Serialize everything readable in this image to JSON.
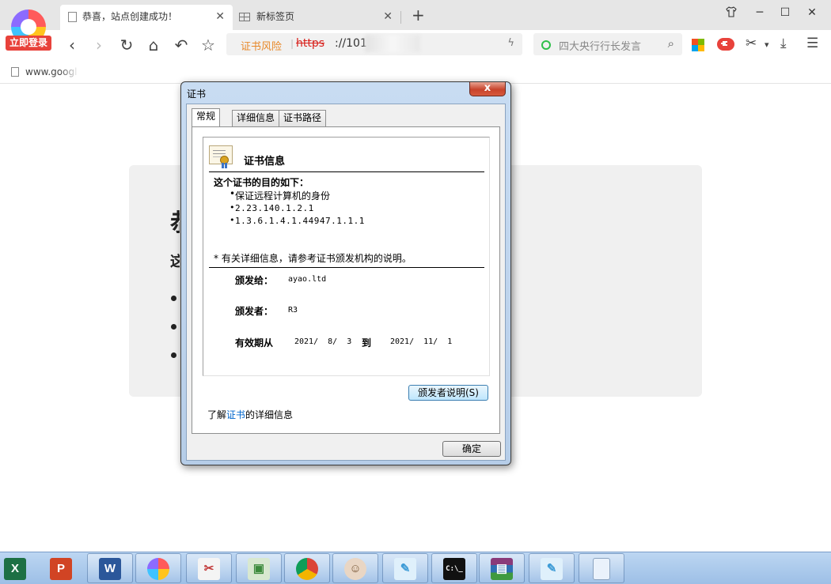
{
  "browser": {
    "login_label": "立即登录",
    "tabs": [
      {
        "title": "恭喜，站点创建成功！",
        "active": true
      },
      {
        "title": "新标签页",
        "active": false
      }
    ],
    "new_tab": "+",
    "window_controls": {
      "skin": "shirt-icon",
      "minimize": "─",
      "maximize": "☐",
      "close": "✕"
    },
    "nav": {
      "back": "‹",
      "forward": "›",
      "reload": "↻",
      "home": "⌂",
      "undo": "↶",
      "star": "☆"
    },
    "address": {
      "risk_label": "证书风险",
      "scheme": "https",
      "host": "://101.32"
    },
    "search": {
      "placeholder": "四大央行行长发言"
    },
    "toolbar_glyphs": {
      "scissors": "✂",
      "dropdown": "▾",
      "download": "⤓",
      "menu": "☰"
    },
    "bookmark": {
      "label": "www.googl"
    }
  },
  "page": {
    "heading": "恭喜",
    "subheading": "这"
  },
  "dialog": {
    "title": "证书",
    "close": "x",
    "tabs": [
      "常规",
      "详细信息",
      "证书路径"
    ],
    "info_title": "证书信息",
    "purpose_title": "这个证书的目的如下：",
    "purposes": [
      "保证远程计算机的身份",
      "2.23.140.1.2.1",
      "1.3.6.1.4.1.44947.1.1.1"
    ],
    "note": "* 有关详细信息，请参考证书颁发机构的说明。",
    "issued_to_label": "颁发给：",
    "issued_to": "ayao.ltd",
    "issued_by_label": "颁发者：",
    "issued_by": "R3",
    "valid_label": "有效期从",
    "valid_from": "2021/  8/  3",
    "valid_to_label": "到",
    "valid_to": "2021/  11/  1",
    "issuer_statement_button": "颁发者说明(S)",
    "learn_prefix": "了解",
    "learn_link": "证书",
    "learn_suffix": "的详细信息",
    "ok_button": "确定"
  },
  "taskbar": {
    "items": [
      {
        "name": "excel",
        "glyph": "X",
        "color": "#1d7044"
      },
      {
        "name": "powerpoint",
        "glyph": "P",
        "color": "#d14424"
      },
      {
        "name": "word",
        "glyph": "W",
        "color": "#2b579a"
      },
      {
        "name": "browser",
        "glyph": "",
        "color": "#ff7a3d"
      },
      {
        "name": "snipping-tool",
        "glyph": "✂",
        "color": "#c23b3b"
      },
      {
        "name": "remote-desktop",
        "glyph": "▣",
        "color": "#3c8a3c"
      },
      {
        "name": "chrome",
        "glyph": "",
        "color": "#db4437"
      },
      {
        "name": "avatar-app",
        "glyph": "☺",
        "color": "#b08a6a"
      },
      {
        "name": "notepad",
        "glyph": "✎",
        "color": "#3c9bd6"
      },
      {
        "name": "cmd",
        "glyph": "C:\\_",
        "color": "#111111"
      },
      {
        "name": "winrar",
        "glyph": "▤",
        "color": "#8a3a7a"
      },
      {
        "name": "notepad-2",
        "glyph": "✎",
        "color": "#3c9bd6"
      },
      {
        "name": "file",
        "glyph": "",
        "color": "#eaf2fb"
      }
    ]
  }
}
